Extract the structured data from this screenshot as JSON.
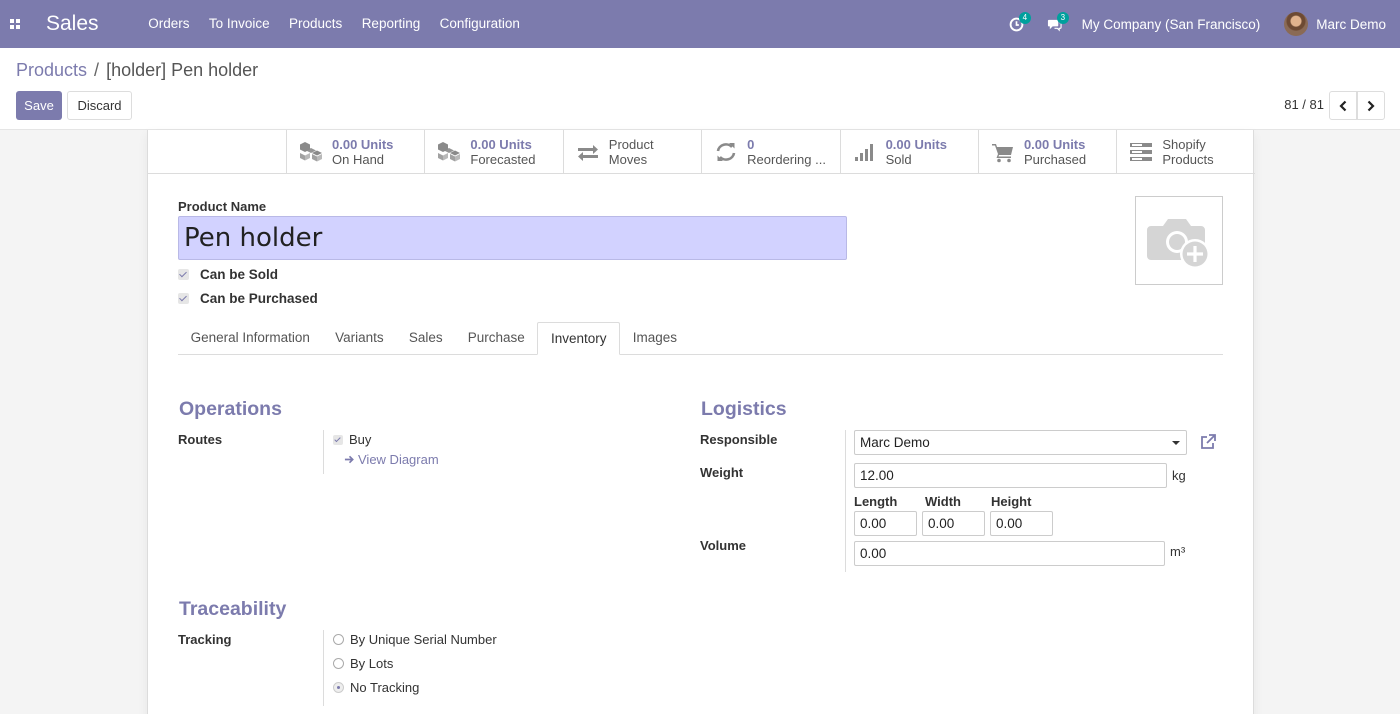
{
  "navbar": {
    "app_name": "Sales",
    "menu": [
      "Orders",
      "To Invoice",
      "Products",
      "Reporting",
      "Configuration"
    ],
    "activity_count": "4",
    "message_count": "3",
    "company": "My Company (San Francisco)",
    "user": "Marc Demo"
  },
  "breadcrumb": {
    "parent": "Products",
    "separator": "/",
    "current": "[holder] Pen holder"
  },
  "buttons": {
    "save": "Save",
    "discard": "Discard"
  },
  "pager": {
    "value": "81 / 81"
  },
  "stat_buttons": [
    {
      "value": "0.00 Units",
      "label": "On Hand",
      "icon": "cubes-icon"
    },
    {
      "value": "0.00 Units",
      "label": "Forecasted",
      "icon": "cubes-icon"
    },
    {
      "value": "Product",
      "label": "Moves",
      "icon": "exchange-icon"
    },
    {
      "value": "0",
      "label": "Reordering ...",
      "icon": "refresh-icon"
    },
    {
      "value": "0.00 Units",
      "label": "Sold",
      "icon": "signal-icon"
    },
    {
      "value": "0.00 Units",
      "label": "Purchased",
      "icon": "cart-icon"
    },
    {
      "value": "Shopify",
      "label": "Products",
      "icon": "server-icon"
    }
  ],
  "product": {
    "name_label": "Product Name",
    "name": "Pen holder",
    "can_be_sold": "Can be Sold",
    "can_be_purchased": "Can be Purchased"
  },
  "tabs": [
    "General Information",
    "Variants",
    "Sales",
    "Purchase",
    "Inventory",
    "Images"
  ],
  "active_tab": "Inventory",
  "operations": {
    "title": "Operations",
    "routes_label": "Routes",
    "route_buy": "Buy",
    "view_diagram": "View Diagram"
  },
  "logistics": {
    "title": "Logistics",
    "responsible_label": "Responsible",
    "responsible": "Marc Demo",
    "weight_label": "Weight",
    "weight": "12.00",
    "weight_unit": "kg",
    "length_label": "Length",
    "width_label": "Width",
    "height_label": "Height",
    "length": "0.00",
    "width": "0.00",
    "height": "0.00",
    "volume_label": "Volume",
    "volume": "0.00",
    "volume_unit": "m³"
  },
  "traceability": {
    "title": "Traceability",
    "tracking_label": "Tracking",
    "options": [
      "By Unique Serial Number",
      "By Lots",
      "No Tracking"
    ],
    "selected": "No Tracking"
  },
  "colors": {
    "brand": "#7c7bad",
    "badge": "#00a09d",
    "name_field": "#d2d2ff"
  }
}
